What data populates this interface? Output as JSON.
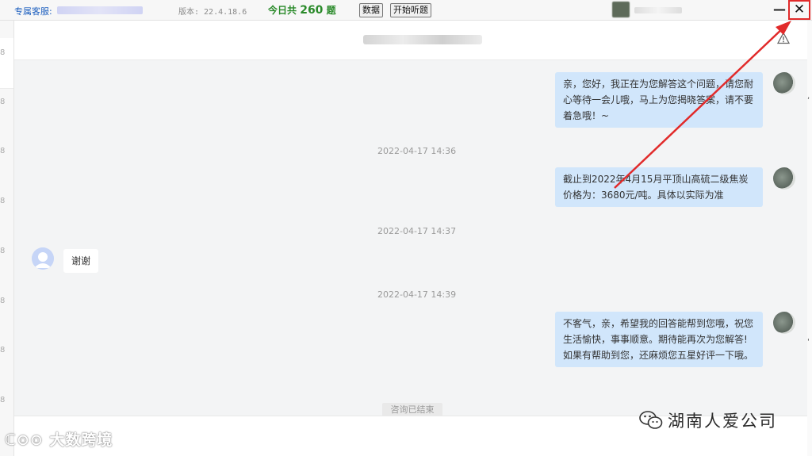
{
  "toolbar": {
    "exclusive_service_label": "专属客服:",
    "version_label": "版本: 22.4.18.6",
    "today_prefix": "今日共",
    "today_count": "260",
    "today_suffix": "题",
    "data_button": "数据",
    "start_listen_button": "开始听题",
    "minimize_glyph": "—",
    "close_glyph": "✕"
  },
  "left_strip_digits": [
    "8",
    "8",
    "8",
    "8",
    "8",
    "8",
    "8",
    "8",
    "8",
    "8"
  ],
  "messages": [
    {
      "role": "agent",
      "text": "亲，您好，我正在为您解答这个问题，请您耐心等待一会儿哦，马上为您揭晓答案，请不要着急哦！~"
    },
    {
      "role": "agent",
      "text": "截止到2022年4月15月平顶山高硫二级焦炭价格为：3680元/吨。具体以实际为准"
    },
    {
      "role": "user",
      "text": "谢谢"
    },
    {
      "role": "agent",
      "text": "不客气，亲，希望我的回答能帮到您哦，祝您生活愉快，事事顺意。期待能再次为您解答!如果有帮助到您，还麻烦您五星好评一下哦。"
    }
  ],
  "timestamps": [
    "2022-04-17 14:36",
    "2022-04-17 14:37",
    "2022-04-17 14:39"
  ],
  "consult_ended": "咨询已结束",
  "watermark_left": "大数跨境",
  "watermark_right": "湖南人爱公司",
  "colors": {
    "annotation": "#e12a2a",
    "agent_bubble": "#d1e6fb",
    "today_count": "#2a8a2a"
  }
}
